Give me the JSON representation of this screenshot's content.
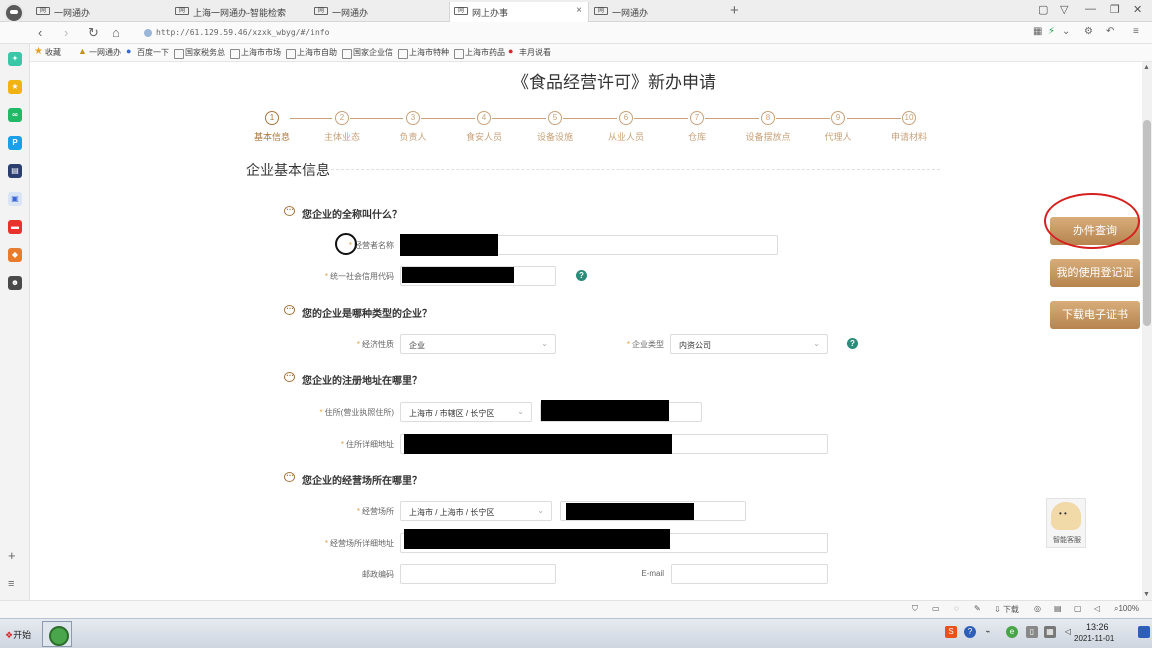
{
  "browser": {
    "tabs": [
      {
        "label": "一网通办"
      },
      {
        "label": "上海一网通办-智能检索"
      },
      {
        "label": "一网通办"
      },
      {
        "label": "网上办事"
      },
      {
        "label": "一网通办"
      }
    ],
    "tab_close": "×",
    "new_tab": "+",
    "url": "http://61.129.59.46/xzxk_wbyg/#/info",
    "bookmarks": [
      "收藏",
      "一网通办",
      "百度一下",
      "国家税务总",
      "上海市市场",
      "上海市自助",
      "国家企业信",
      "上海市特种",
      "上海市药品",
      "丰月说看"
    ]
  },
  "page": {
    "title": "《食品经营许可》新办申请",
    "steps": [
      {
        "num": "1",
        "label": "基本信息"
      },
      {
        "num": "2",
        "label": "主体业态"
      },
      {
        "num": "3",
        "label": "负责人"
      },
      {
        "num": "4",
        "label": "食安人员"
      },
      {
        "num": "5",
        "label": "设备设施"
      },
      {
        "num": "6",
        "label": "从业人员"
      },
      {
        "num": "7",
        "label": "仓库"
      },
      {
        "num": "8",
        "label": "设备摆放点"
      },
      {
        "num": "9",
        "label": "代理人"
      },
      {
        "num": "10",
        "label": "申请材料"
      }
    ],
    "section_title": "企业基本信息",
    "questions": {
      "q1": "您企业的全称叫什么？",
      "q2": "您的企业是哪种类型的企业？",
      "q3": "您企业的注册地址在哪里？",
      "q4": "您企业的经营场所在哪里？"
    },
    "fields": {
      "operator_name_label": "经营者名称",
      "credit_code_label": "统一社会信用代码",
      "econ_nature_label": "经济性质",
      "econ_nature_value": "企业",
      "enterprise_type_label": "企业类型",
      "enterprise_type_value": "内资公司",
      "residence_label": "住所(营业执照住所)",
      "residence_region_value": "上海市 / 市辖区 / 长宁区",
      "residence_detail_label": "住所详细地址",
      "premises_label": "经营场所",
      "premises_region_value": "上海市 / 上海市 / 长宁区",
      "premises_detail_label": "经营场所详细地址",
      "postcode_label": "邮政编码",
      "email_label": "E-mail"
    },
    "side_buttons": [
      "办件查询",
      "我的使用登记证",
      "下载电子证书"
    ],
    "assistant_label": "智能客服"
  },
  "statusbar": {
    "download_label": "下载",
    "zoom": "100%"
  },
  "taskbar": {
    "start_label": "开始",
    "time": "13:26",
    "date": "2021-11-01"
  }
}
